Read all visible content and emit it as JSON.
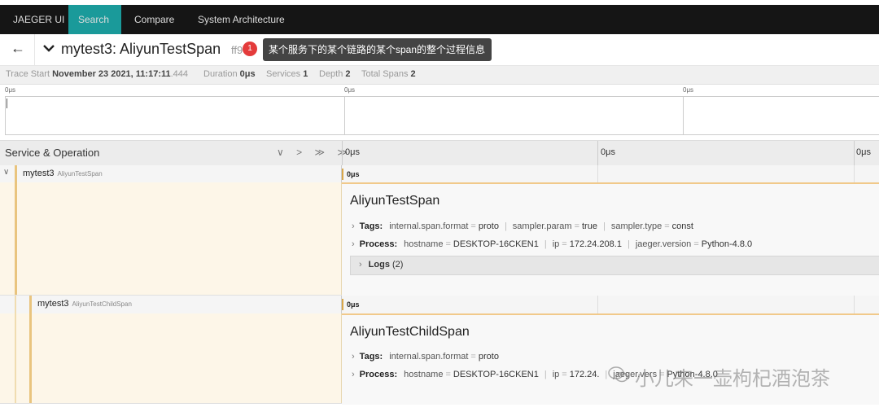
{
  "nav": {
    "brand": "JAEGER UI",
    "search": "Search",
    "compare": "Compare",
    "system_architecture": "System Architecture"
  },
  "trace": {
    "back_icon": "←",
    "title": "mytest3: AliyunTestSpan",
    "trace_id_partial": "ff9",
    "badge": "1",
    "tooltip": "某个服务下的某个链路的某个span的整个过程信息"
  },
  "meta": {
    "trace_start_label": "Trace Start",
    "trace_start_value": "November 23 2021, 11:17:11",
    "trace_start_ms": ".444",
    "duration_label": "Duration",
    "duration_value": "0μs",
    "services_label": "Services",
    "services_value": "1",
    "depth_label": "Depth",
    "depth_value": "2",
    "total_spans_label": "Total Spans",
    "total_spans_value": "2"
  },
  "minimap": {
    "ticks": [
      "0μs",
      "0μs",
      "0μs"
    ]
  },
  "header": {
    "service_operation": "Service & Operation",
    "icons": "∨ > ≫ ≫",
    "ticks": [
      "0μs",
      "0μs",
      "0μs"
    ]
  },
  "spans": [
    {
      "service": "mytest3",
      "operation": "AliyunTestSpan",
      "duration": "0μs",
      "detail": {
        "title": "AliyunTestSpan",
        "tags_label": "Tags:",
        "tags": [
          {
            "k": "internal.span.format",
            "v": "proto"
          },
          {
            "k": "sampler.param",
            "v": "true"
          },
          {
            "k": "sampler.type",
            "v": "const"
          }
        ],
        "process_label": "Process:",
        "process": [
          {
            "k": "hostname",
            "v": "DESKTOP-16CKEN1"
          },
          {
            "k": "ip",
            "v": "172.24.208.1"
          },
          {
            "k": "jaeger.version",
            "v": "Python-4.8.0"
          }
        ],
        "logs_label": "Logs",
        "logs_count": "(2)"
      }
    },
    {
      "service": "mytest3",
      "operation": "AliyunTestChildSpan",
      "duration": "0μs",
      "detail": {
        "title": "AliyunTestChildSpan",
        "tags_label": "Tags:",
        "tags": [
          {
            "k": "internal.span.format",
            "v": "proto"
          }
        ],
        "process_label": "Process:",
        "process": [
          {
            "k": "hostname",
            "v": "DESKTOP-16CKEN1"
          },
          {
            "k": "ip",
            "v": "172.24."
          },
          {
            "k": "jaeger.vers",
            "v": "Python-4.8.0"
          }
        ]
      }
    }
  ],
  "watermark": "小儿来一壶枸杞酒泡茶",
  "colors": {
    "nav_bg": "#151515",
    "nav_active": "#1a9a9a",
    "span_service": "#e9c47e",
    "badge": "#e43b3b"
  }
}
